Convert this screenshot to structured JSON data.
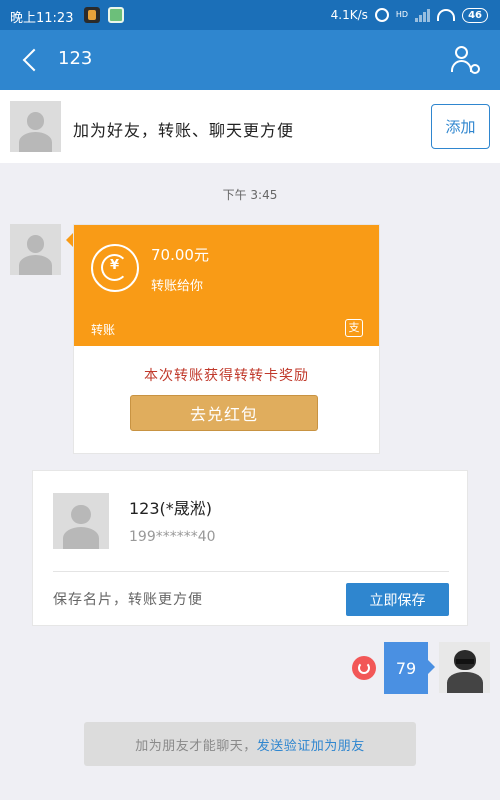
{
  "status_bar": {
    "time": "晚上11:23",
    "network_speed": "4.1K/s",
    "hd_label": "HD",
    "battery": "46"
  },
  "header": {
    "title": "123"
  },
  "add_friend_banner": {
    "text": "加为好友，转账、聊天更方便",
    "add_button_label": "添加"
  },
  "chat": {
    "timestamp": "下午 3:45",
    "transfer": {
      "icon_symbol": "¥",
      "amount": "70.00元",
      "subtitle": "转账给你",
      "label": "转账",
      "reward_text": "本次转账获得转转卡奖励",
      "redeem_button_label": "去兑红包"
    },
    "contact_card": {
      "name": "123(*晟淞)",
      "phone": "199******40",
      "hint": "保存名片，转账更方便",
      "save_button_label": "立即保存"
    },
    "outgoing_message": {
      "text": "79"
    }
  },
  "footer_notice": {
    "text": "加为朋友才能聊天，",
    "link_text": "发送验证加为朋友"
  },
  "colors": {
    "header_blue": "#2f86cf",
    "transfer_orange": "#f99b16",
    "redeem_gold": "#e0ad5d",
    "retry_red": "#f25757"
  }
}
